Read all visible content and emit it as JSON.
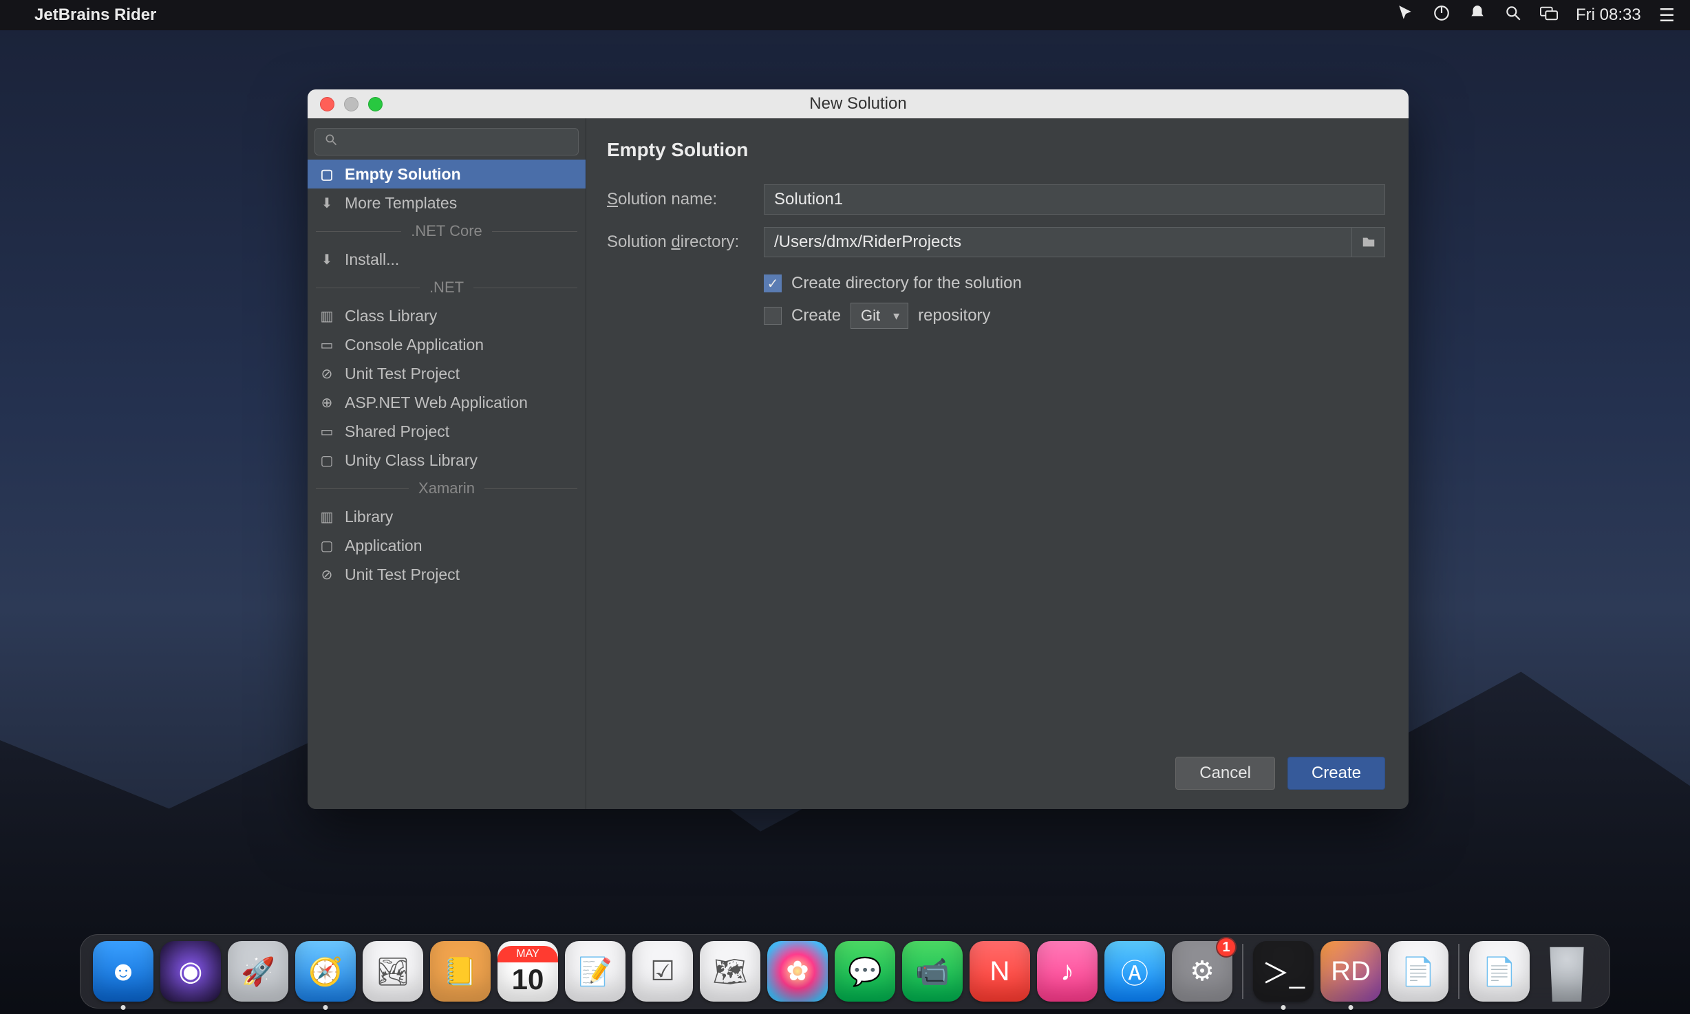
{
  "menubar": {
    "app_name": "JetBrains Rider",
    "clock": "Fri 08:33"
  },
  "dialog": {
    "title": "New Solution"
  },
  "sidebar": {
    "items": [
      {
        "icon": "▢",
        "label": "Empty Solution",
        "selected": true
      },
      {
        "icon": "⬇",
        "label": "More Templates"
      }
    ],
    "group1_title": ".NET Core",
    "group1_items": [
      {
        "icon": "⬇",
        "label": "Install..."
      }
    ],
    "group2_title": ".NET",
    "group2_items": [
      {
        "icon": "▥",
        "label": "Class Library"
      },
      {
        "icon": "▭",
        "label": "Console Application"
      },
      {
        "icon": "⊘",
        "label": "Unit Test Project"
      },
      {
        "icon": "⊕",
        "label": "ASP.NET Web Application"
      },
      {
        "icon": "▭",
        "label": "Shared Project"
      },
      {
        "icon": "▢",
        "label": "Unity Class Library"
      }
    ],
    "group3_title": "Xamarin",
    "group3_items": [
      {
        "icon": "▥",
        "label": "Library"
      },
      {
        "icon": "▢",
        "label": "Application"
      },
      {
        "icon": "⊘",
        "label": "Unit Test Project"
      }
    ]
  },
  "form": {
    "heading": "Empty Solution",
    "name_label_pre": "S",
    "name_label_rest": "olution name:",
    "name_value": "Solution1",
    "dir_label_pre": "Solution ",
    "dir_label_u": "d",
    "dir_label_rest": "irectory:",
    "dir_value": "/Users/dmx/RiderProjects",
    "check_create_dir_label": "Create directory for the solution",
    "check_create_dir_checked": true,
    "check_create_repo_label_pre": "Create",
    "check_create_repo_label_post": "repository",
    "repo_type": "Git",
    "check_create_repo_checked": false
  },
  "buttons": {
    "cancel": "Cancel",
    "create": "Create"
  },
  "dock": {
    "cal_month": "MAY",
    "cal_day": "10",
    "badge_sysprefs": "1"
  }
}
